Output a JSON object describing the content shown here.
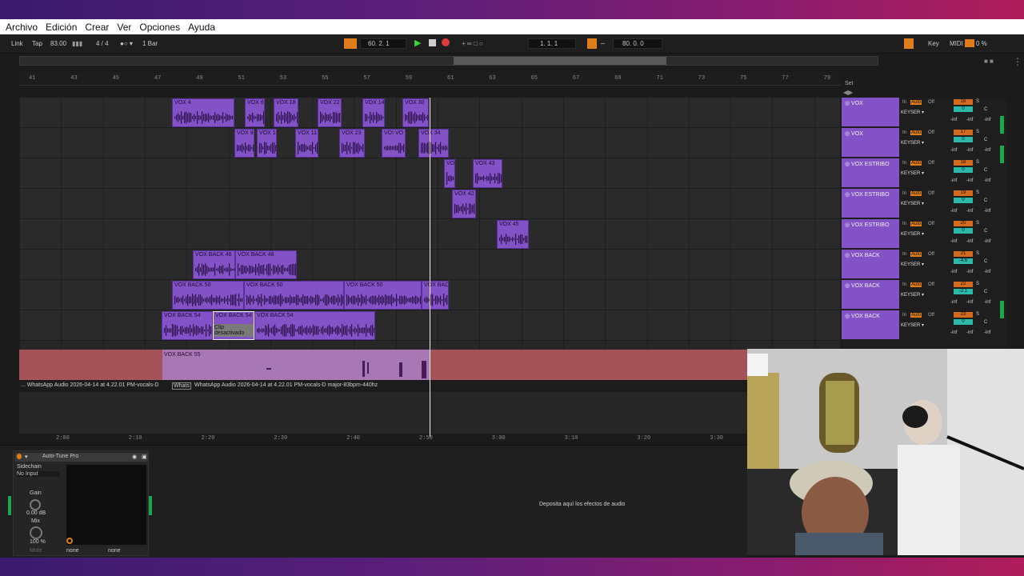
{
  "menu": [
    "Archivo",
    "Edición",
    "Crear",
    "Ver",
    "Opciones",
    "Ayuda"
  ],
  "transport": {
    "link": "Link",
    "tap": "Tap",
    "tempo": "83.00",
    "signature": "4 / 4",
    "quantize": "1 Bar",
    "position": "60. 2. 1",
    "loop_start": "1. 1. 1",
    "loop_length": "80. 0. 0",
    "key": "Key",
    "midi": "MIDI",
    "cpu": "0 %"
  },
  "ruler": [
    "41",
    "43",
    "45",
    "47",
    "49",
    "51",
    "53",
    "55",
    "57",
    "59",
    "61",
    "63",
    "65",
    "67",
    "69",
    "71",
    "73",
    "75",
    "77",
    "79"
  ],
  "set_label": "Set",
  "clips": [
    {
      "row": 0,
      "label": "VOX 4",
      "start": 215,
      "end": 293
    },
    {
      "row": 0,
      "label": "VOX 6",
      "start": 306,
      "end": 331
    },
    {
      "row": 0,
      "label": "VOX 18",
      "start": 342,
      "end": 373
    },
    {
      "row": 0,
      "label": "VOX 22",
      "start": 397,
      "end": 427
    },
    {
      "row": 0,
      "label": "VOX 14",
      "start": 453,
      "end": 481
    },
    {
      "row": 0,
      "label": "VOX 30",
      "start": 503,
      "end": 536
    },
    {
      "row": 1,
      "label": "VOX 9",
      "start": 293,
      "end": 318
    },
    {
      "row": 1,
      "label": "VOX 1:",
      "start": 321,
      "end": 346
    },
    {
      "row": 1,
      "label": "VOX 11",
      "start": 369,
      "end": 398
    },
    {
      "row": 1,
      "label": "VOX 23",
      "start": 424,
      "end": 456
    },
    {
      "row": 1,
      "label": "VO! VO",
      "start": 477,
      "end": 507
    },
    {
      "row": 1,
      "label": "VOX 34",
      "start": 523,
      "end": 561
    },
    {
      "row": 2,
      "label": "VO)",
      "start": 555,
      "end": 569
    },
    {
      "row": 2,
      "label": "VOX 43",
      "start": 591,
      "end": 628
    },
    {
      "row": 3,
      "label": "VOX 42",
      "start": 565,
      "end": 595
    },
    {
      "row": 4,
      "label": "VOX 45",
      "start": 621,
      "end": 661
    },
    {
      "row": 5,
      "label": "VOX BACK 46",
      "start": 241,
      "end": 294
    },
    {
      "row": 5,
      "label": "VOX BACK 48",
      "start": 294,
      "end": 371
    },
    {
      "row": 6,
      "label": "VOX BACK 50",
      "start": 215,
      "end": 305
    },
    {
      "row": 6,
      "label": "VOX BACK 50",
      "start": 305,
      "end": 430
    },
    {
      "row": 6,
      "label": "VOX BACK 50",
      "start": 430,
      "end": 527
    },
    {
      "row": 6,
      "label": "VOX BACI",
      "start": 527,
      "end": 561
    },
    {
      "row": 7,
      "label": "VOX BACK 54",
      "start": 202,
      "end": 266
    },
    {
      "row": 7,
      "label": "VOX BACK 54",
      "start": 266,
      "end": 318
    },
    {
      "row": 7,
      "label": "VOX BACK 54",
      "start": 318,
      "end": 469
    }
  ],
  "clip_deactivated": "Clip desactivado",
  "red_clip_label": "VOX BACK 55",
  "audio_file": {
    "left": "... WhatsApp Audio 2026-04-14 at 4.22.01 PM-vocals-D",
    "mid": "Whats",
    "right": "WhatsApp Audio 2026-04-14 at 4.22.01 PM-vocals-D major-83bpm-440hz"
  },
  "timebar": [
    "2:00",
    "2:10",
    "2:20",
    "2:30",
    "2:40",
    "2:50",
    "3:00",
    "3:10",
    "3:20",
    "3:30"
  ],
  "tracks": [
    {
      "name": "VOX",
      "num": "16",
      "vol": "0",
      "keyser": "KEYSER"
    },
    {
      "name": "VOX",
      "num": "17",
      "vol": "0",
      "keyser": "KEYSER"
    },
    {
      "name": "VOX ESTRIBO",
      "num": "18",
      "vol": "0",
      "keyser": "KEYSER"
    },
    {
      "name": "VOX ESTRIBO",
      "num": "19",
      "vol": "0",
      "keyser": "KEYSER"
    },
    {
      "name": "VOX ESTRIBO",
      "num": "20",
      "vol": "0",
      "keyser": "KEYSER"
    },
    {
      "name": "VOX BACK",
      "num": "21",
      "vol": "-4.6",
      "keyser": "KEYSER"
    },
    {
      "name": "VOX BACK",
      "num": "22",
      "vol": "-2.1",
      "keyser": "KEYSER"
    },
    {
      "name": "VOX BACK",
      "num": "23",
      "vol": "0",
      "keyser": "KEYSER"
    }
  ],
  "mixer_labels": {
    "in": "In",
    "auto": "Auto",
    "off": "Off",
    "s": "S",
    "c": "C",
    "inf": "-inf"
  },
  "device": {
    "title": "Auto-Tune Pro",
    "sidechain": "Sidechain",
    "no_input": "No Input",
    "gain": "Gain",
    "gain_val": "0.00 dB",
    "mix": "Mix",
    "mix_val": "100 %",
    "mute": "Mute",
    "none1": "none",
    "none2": "none"
  },
  "drop_text": "Deposita aquí los efectos de audio",
  "colors": {
    "clip": "#8452c7",
    "accent": "#e07c1a",
    "red_track": "#a45358"
  }
}
